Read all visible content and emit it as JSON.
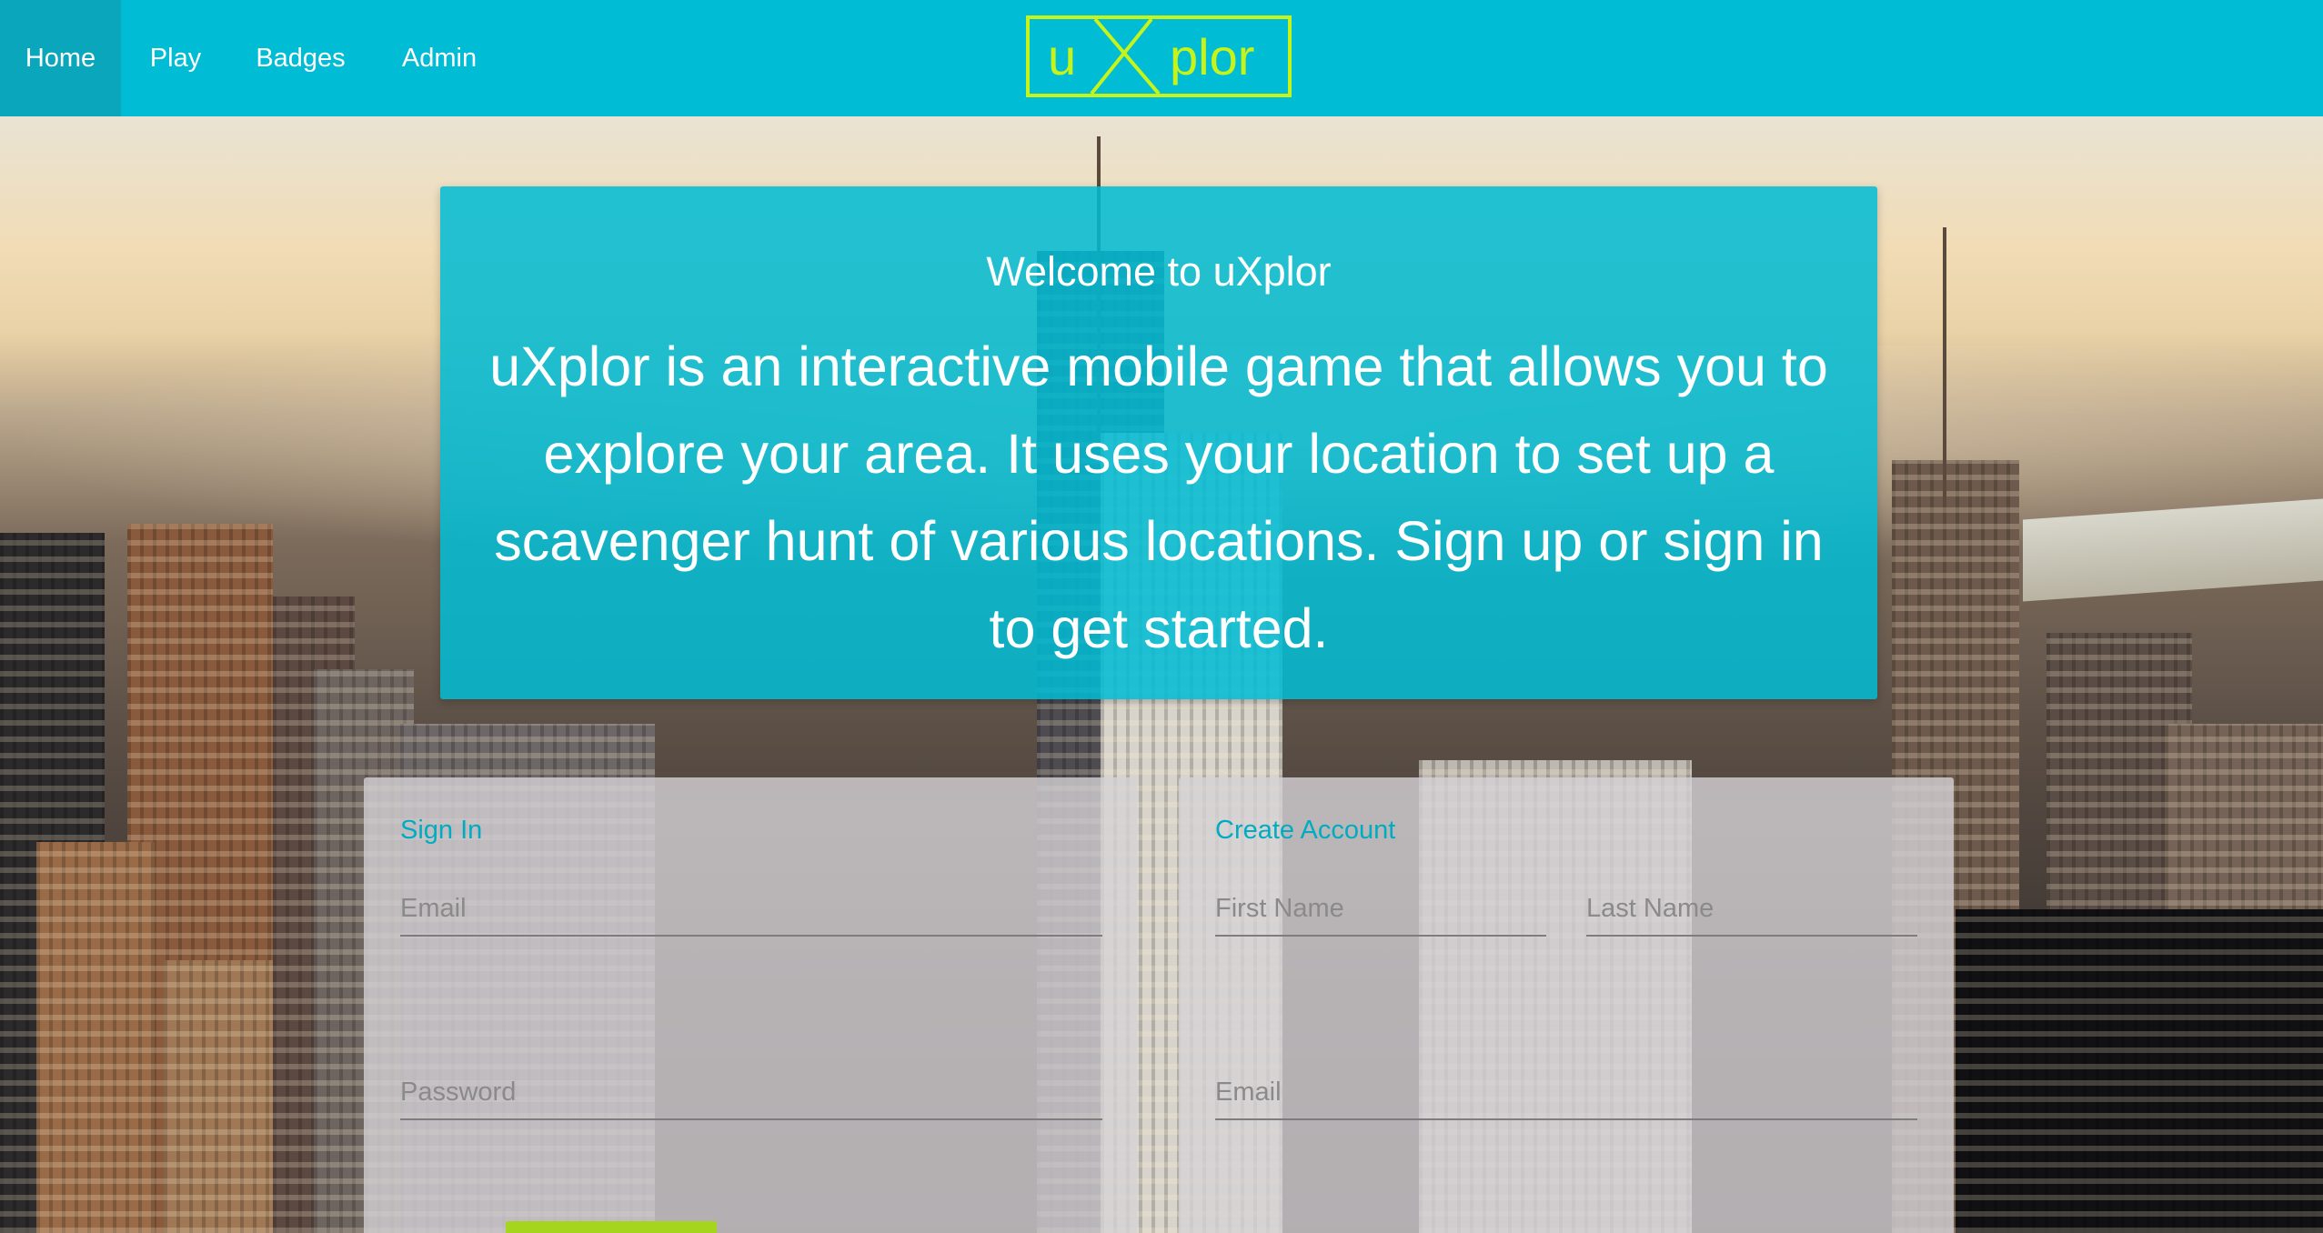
{
  "nav": {
    "items": [
      {
        "label": "Home",
        "active": true
      },
      {
        "label": "Play",
        "active": false
      },
      {
        "label": "Badges",
        "active": false
      },
      {
        "label": "Admin",
        "active": false
      }
    ],
    "logo": {
      "left": "u",
      "middle": "X",
      "right": "plor"
    }
  },
  "welcome": {
    "title": "Welcome to uXplor",
    "description": "uXplor is an interactive mobile game that allows you to explore your area. It uses your location to set up a scavenger hunt of various locations. Sign up or sign in to get started."
  },
  "sign_in": {
    "title": "Sign In",
    "email_placeholder": "Email",
    "password_placeholder": "Password"
  },
  "create_account": {
    "title": "Create Account",
    "first_name_placeholder": "First Name",
    "last_name_placeholder": "Last Name",
    "email_placeholder": "Email"
  },
  "colors": {
    "primary": "#00bcd4",
    "nav_active": "#0aa6bb",
    "logo": "#c6f31a",
    "form_title": "#00acc1",
    "button": "#a5d51c"
  }
}
